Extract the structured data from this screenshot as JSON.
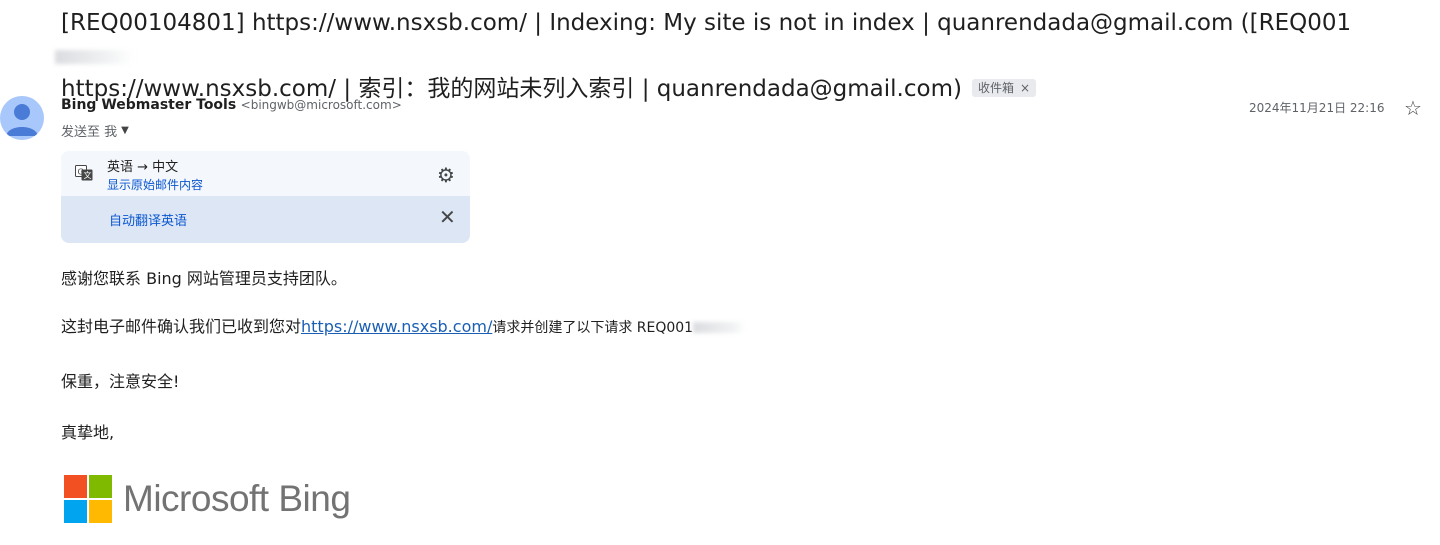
{
  "subject": {
    "line1": "[REQ00104801] https://www.nsxsb.com/ | Indexing: My site is not in index | quanrendada@gmail.com ([REQ001",
    "line2": "https://www.nsxsb.com/ | 索引：我的网站未列入索引 | quanrendada@gmail.com)",
    "label": "收件箱",
    "label_close": "×"
  },
  "sender": {
    "name": "Bing Webmaster Tools",
    "email": "<bingwb@microsoft.com>",
    "to": "发送至 我",
    "date": "2024年11月21日 22:16"
  },
  "translate": {
    "lang": "英语 → 中文",
    "show_original": "显示原始邮件内容",
    "auto_translate": "自动翻译英语"
  },
  "body": {
    "p1": "感谢您联系 Bing 网站管理员支持团队。",
    "p2_prefix": "这封电子邮件确认我们已收到您对",
    "p2_link": "https://www.nsxsb.com/",
    "p2_suffix": "请求并创建了以下请求 REQ001",
    "p3": "保重，注意安全!",
    "p4": "真挚地,"
  },
  "logo": {
    "text": "Microsoft Bing",
    "colors": [
      "#f25022",
      "#7fba00",
      "#00a4ef",
      "#ffb900"
    ]
  },
  "icons": {
    "translate": "translate-icon",
    "gear": "settings-icon",
    "close": "close-icon",
    "star": "star-icon",
    "avatar": "avatar-icon"
  }
}
